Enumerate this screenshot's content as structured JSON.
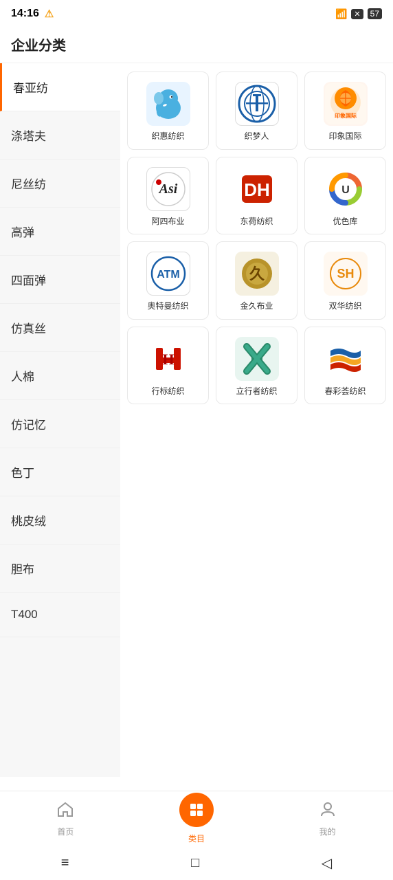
{
  "statusBar": {
    "time": "14:16",
    "battery": "57"
  },
  "header": {
    "title": "企业分类"
  },
  "sidebar": {
    "items": [
      {
        "id": "chunyafang",
        "label": "春亚纺",
        "active": true
      },
      {
        "id": "tutafu",
        "label": "涤塔夫",
        "active": false
      },
      {
        "id": "nisifang",
        "label": "尼丝纺",
        "active": false
      },
      {
        "id": "gaodan",
        "label": "高弹",
        "active": false
      },
      {
        "id": "simiantan",
        "label": "四面弹",
        "active": false
      },
      {
        "id": "fenzhensi",
        "label": "仿真丝",
        "active": false
      },
      {
        "id": "renmian",
        "label": "人棉",
        "active": false
      },
      {
        "id": "fenjivi",
        "label": "仿记忆",
        "active": false
      },
      {
        "id": "seding",
        "label": "色丁",
        "active": false
      },
      {
        "id": "taopirong",
        "label": "桃皮绒",
        "active": false
      },
      {
        "id": "danbu",
        "label": "胆布",
        "active": false
      },
      {
        "id": "t400",
        "label": "T400",
        "active": false
      }
    ]
  },
  "products": [
    {
      "id": "zhihui",
      "name": "织惠纺织",
      "logoType": "zhihui"
    },
    {
      "id": "zhimeng",
      "name": "织梦人",
      "logoType": "zhimeng"
    },
    {
      "id": "yinxiang",
      "name": "印象国际",
      "logoType": "yinxiang"
    },
    {
      "id": "asi",
      "name": "阿四布业",
      "logoType": "asi"
    },
    {
      "id": "dh",
      "name": "东荷纺织",
      "logoType": "dh"
    },
    {
      "id": "youse",
      "name": "优色库",
      "logoType": "youse"
    },
    {
      "id": "atm",
      "name": "奥特曼纺织",
      "logoType": "atm"
    },
    {
      "id": "jinju",
      "name": "金久布业",
      "logoType": "jinju"
    },
    {
      "id": "shuanghua",
      "name": "双华纺织",
      "logoType": "shuanghua"
    },
    {
      "id": "hangbiao",
      "name": "行标纺织",
      "logoType": "hangbiao"
    },
    {
      "id": "lixing",
      "name": "立行者纺织",
      "logoType": "lixing"
    },
    {
      "id": "chuncai",
      "name": "春彩荟纺织",
      "logoType": "chuncai"
    }
  ],
  "bottomNav": {
    "items": [
      {
        "id": "home",
        "label": "首页",
        "active": false
      },
      {
        "id": "category",
        "label": "类目",
        "active": true
      },
      {
        "id": "mine",
        "label": "我的",
        "active": false
      }
    ]
  },
  "systemBar": {
    "menu": "≡",
    "home": "□",
    "back": "◁"
  }
}
